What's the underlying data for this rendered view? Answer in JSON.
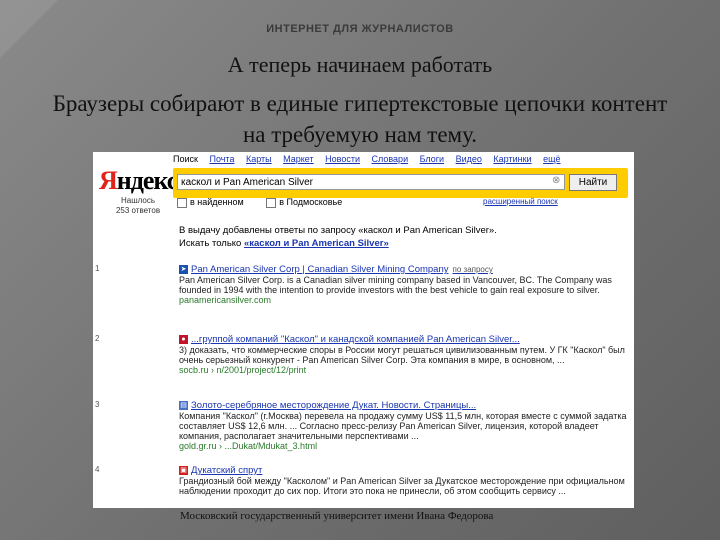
{
  "slide": {
    "header": "ИНТЕРНЕТ ДЛЯ ЖУРНАЛИСТОВ",
    "title": "А теперь начинаем работать",
    "body": "Браузеры собирают в единые гипертекстовые цепочки контент на требуемую нам тему.",
    "footer": "Московский государственный университет имени Ивана Федорова"
  },
  "yandex": {
    "nav": [
      "Поиск",
      "Почта",
      "Карты",
      "Маркет",
      "Новости",
      "Словари",
      "Блоги",
      "Видео",
      "Картинки",
      "ещё"
    ],
    "logo": "Яндекс",
    "found_line1": "Нашлось",
    "found_line2": "253 ответов",
    "query": "каскол и Pan American Silver",
    "search_button": "Найти",
    "checkbox_region": "в найденном",
    "checkbox_area": "в Подмосковье",
    "advanced": "расширенный поиск",
    "note_line1": "В выдачу добавлены ответы по запросу «каскол и Pan American Silver».",
    "note_line2_prefix": "Искать только ",
    "note_line2_link": "«каскол и Pan American Silver»",
    "results": [
      {
        "num": "1",
        "title": "Pan American Silver Corp | Canadian Silver Mining Company",
        "hint": "по запросу",
        "snippet": "Pan American Silver Corp. is a Canadian silver mining company based in Vancouver, BC. The Company was founded in 1994 with the intention to provide investors with the best vehicle to gain real exposure to silver.",
        "url": "panamericansilver.com"
      },
      {
        "num": "2",
        "title": "...группой компаний \"Каскол\" и канадской компанией Pan American Silver...",
        "hint": "",
        "snippet": "3) доказать, что коммерческие споры в России могут решаться цивилизованным путем. У ГК \"Каскол\" был очень серьезный конкурент - Pan American Silver Corp. Эта компания в мире, в основном, ...",
        "url": "socb.ru › n/2001/project/12/print"
      },
      {
        "num": "3",
        "title": "Золото-серебряное месторождение Дукат. Новости. Страницы...",
        "hint": "",
        "snippet": "Компания \"Каскол\" (г.Москва) перевела на продажу сумму US$ 11,5 млн, которая вместе с суммой задатка составляет US$ 12,6 млн. ... Согласно пресс-релизу Pan American Silver, лицензия, которой владеет компания, располагает значительными перспективами ...",
        "url": "gold.gr.ru › ...Dukat/Mdukat_3.html"
      },
      {
        "num": "4",
        "title": "Дукатский спрут",
        "hint": "",
        "snippet": "Грандиозный бой между \"Касколом\" и Pan American Silver за Дукатское месторождение при официальном наблюдении проходит до сих пор. Итоги это пока не принесли, об этом сообщить сервису ...",
        "url": ""
      }
    ]
  }
}
